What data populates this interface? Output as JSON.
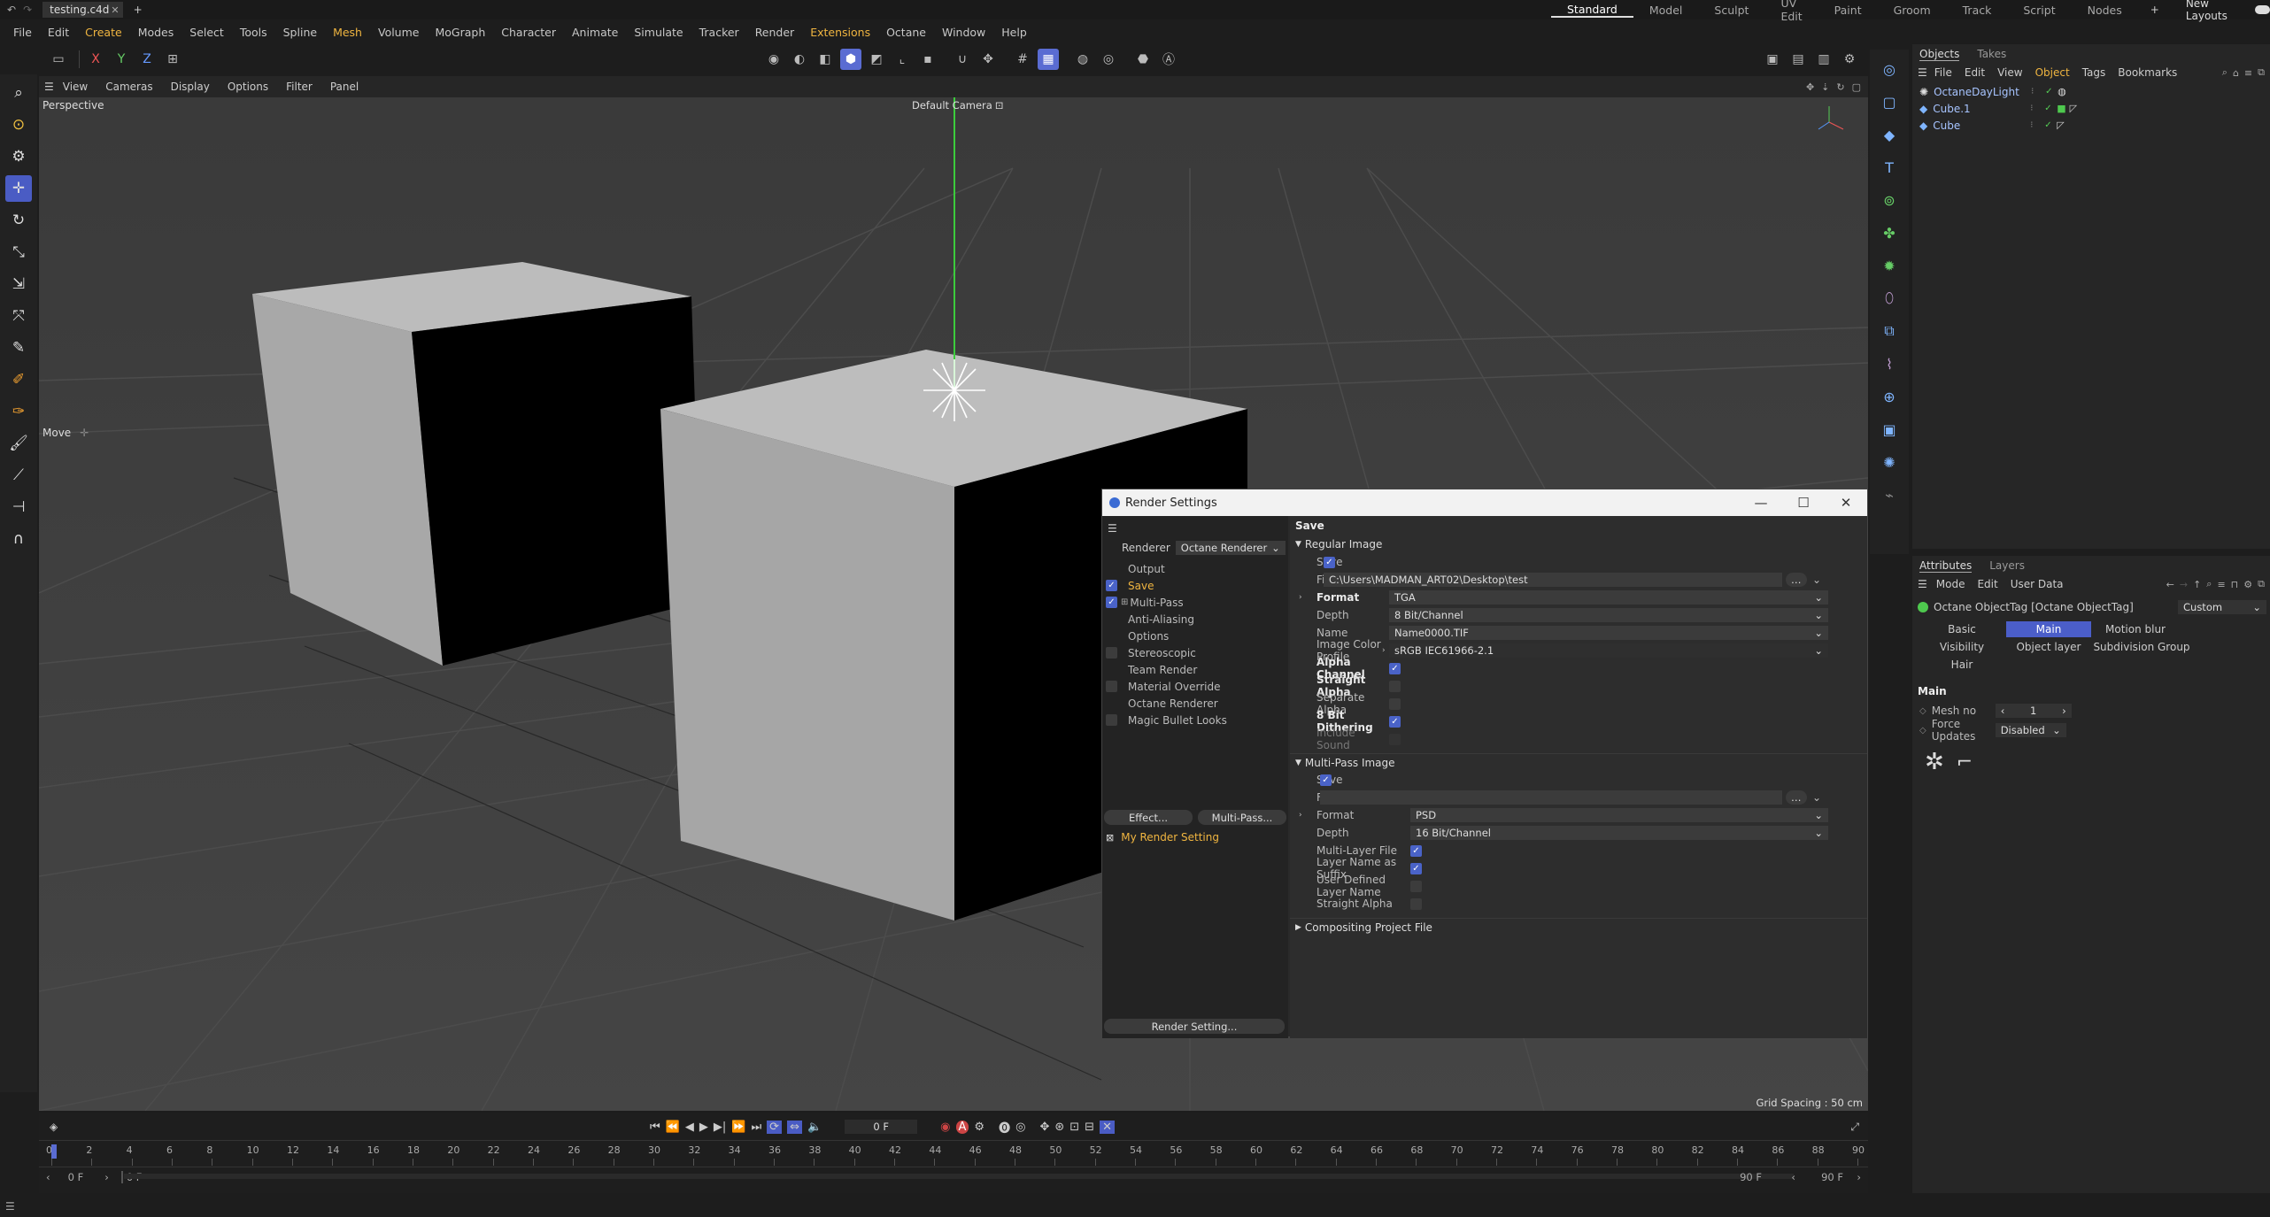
{
  "titlebar": {
    "filename": "testing.c4d",
    "plus": "+"
  },
  "layouts": {
    "items": [
      "Standard",
      "Model",
      "Sculpt",
      "UV Edit",
      "Paint",
      "Groom",
      "Track",
      "Script",
      "Nodes"
    ],
    "new_layouts": "New Layouts"
  },
  "menu": {
    "items": [
      "File",
      "Edit",
      "Create",
      "Modes",
      "Select",
      "Tools",
      "Spline",
      "Mesh",
      "Volume",
      "MoGraph",
      "Character",
      "Animate",
      "Simulate",
      "Tracker",
      "Render",
      "Extensions",
      "Octane",
      "Window",
      "Help"
    ],
    "highlight": [
      "Create",
      "Mesh",
      "Extensions"
    ]
  },
  "toolbar": {
    "x": "X",
    "y": "Y",
    "z": "Z"
  },
  "viewport": {
    "menu": [
      "View",
      "Cameras",
      "Display",
      "Options",
      "Filter",
      "Panel"
    ],
    "label": "Perspective",
    "camera": "Default Camera",
    "move_label": "Move",
    "grid_spacing": "Grid Spacing : 50 cm"
  },
  "objects": {
    "tabs": [
      "Objects",
      "Takes"
    ],
    "menu": [
      "File",
      "Edit",
      "View",
      "Object",
      "Tags",
      "Bookmarks"
    ],
    "rows": [
      "OctaneDayLight",
      "Cube.1",
      "Cube"
    ]
  },
  "attributes": {
    "tabs": [
      "Attributes",
      "Layers"
    ],
    "menu": [
      "Mode",
      "Edit",
      "User Data"
    ],
    "tag_name": "Octane ObjectTag [Octane ObjectTag]",
    "preset": "Custom",
    "tabs_row1": [
      "Basic",
      "Main",
      "Motion blur"
    ],
    "tabs_row2": [
      "Visibility",
      "Object layer",
      "Subdivision Group"
    ],
    "tabs_row3": [
      "Hair"
    ],
    "section": "Main",
    "mesh_no_label": "Mesh no",
    "mesh_no_value": "1",
    "force_updates_label": "Force Updates",
    "force_updates_value": "Disabled"
  },
  "dialog": {
    "title": "Render Settings",
    "renderer_label": "Renderer",
    "renderer_value": "Octane Renderer",
    "tree": [
      {
        "label": "Output",
        "check": "none"
      },
      {
        "label": "Save",
        "check": "on",
        "active": true
      },
      {
        "label": "Multi-Pass",
        "check": "on",
        "expand": true
      },
      {
        "label": "Anti-Aliasing",
        "check": "none"
      },
      {
        "label": "Options",
        "check": "none"
      },
      {
        "label": "Stereoscopic",
        "check": "off"
      },
      {
        "label": "Team Render",
        "check": "none"
      },
      {
        "label": "Material Override",
        "check": "off"
      },
      {
        "label": "Octane Renderer",
        "check": "none"
      },
      {
        "label": "Magic Bullet Looks",
        "check": "off"
      }
    ],
    "effect_button": "Effect...",
    "multipass_button": "Multi-Pass...",
    "render_setting_name": "My Render Setting",
    "render_setting_button": "Render Setting...",
    "panel_title": "Save",
    "regular": {
      "title": "Regular Image",
      "save": "Save",
      "file_label": "File...",
      "file_value": "C:\\Users\\MADMAN_ART02\\Desktop\\test",
      "format_label": "Format",
      "format_value": "TGA",
      "depth_label": "Depth",
      "depth_value": "8 Bit/Channel",
      "name_label": "Name",
      "name_value": "Name0000.TIF",
      "profile_label": "Image Color Profile",
      "profile_value": "sRGB IEC61966-2.1",
      "alpha": "Alpha Channel",
      "straight": "Straight Alpha",
      "separate": "Separate Alpha",
      "dither": "8 Bit Dithering",
      "sound": "Include Sound"
    },
    "multipass": {
      "title": "Multi-Pass Image",
      "save": "Save",
      "file_label": "File",
      "format_label": "Format",
      "format_value": "PSD",
      "depth_label": "Depth",
      "depth_value": "16 Bit/Channel",
      "multilayer": "Multi-Layer File",
      "suffix": "Layer Name as Suffix",
      "userdef": "User Defined Layer Name",
      "straight": "Straight Alpha"
    },
    "compositing": "Compositing Project File"
  },
  "timeline": {
    "current_frame": "0 F",
    "start": "0 F",
    "start2": "0 F",
    "end": "90 F",
    "end2": "90 F",
    "ticks": [
      "0",
      "2",
      "4",
      "6",
      "8",
      "10",
      "12",
      "14",
      "16",
      "18",
      "20",
      "22",
      "24",
      "26",
      "28",
      "30",
      "32",
      "34",
      "36",
      "38",
      "40",
      "42",
      "44",
      "46",
      "48",
      "50",
      "52",
      "54",
      "56",
      "58",
      "60",
      "62",
      "64",
      "66",
      "68",
      "70",
      "72",
      "74",
      "76",
      "78",
      "80",
      "82",
      "84",
      "86",
      "88",
      "90"
    ]
  },
  "colors": {
    "accent": "#4a5cc4",
    "highlight": "#f0b540",
    "green": "#4ec94e"
  }
}
